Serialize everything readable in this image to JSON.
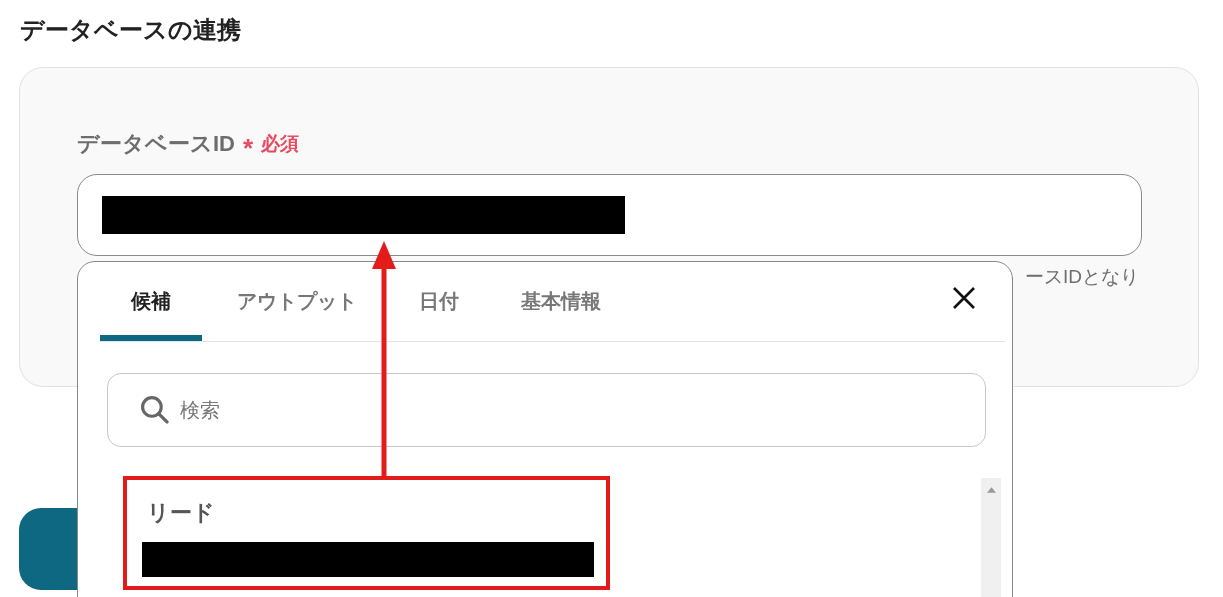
{
  "section_title": "データベースの連携",
  "field": {
    "label": "データベースID",
    "required_mark": "*",
    "required_label": "必須",
    "hint": "ースIDとなり"
  },
  "popup": {
    "tabs": [
      {
        "label": "候補",
        "selected": true
      },
      {
        "label": "アウトプット",
        "selected": false
      },
      {
        "label": "日付",
        "selected": false
      },
      {
        "label": "基本情報",
        "selected": false
      }
    ],
    "search": {
      "placeholder": "検索"
    },
    "items": [
      {
        "title": "リード"
      }
    ]
  }
}
